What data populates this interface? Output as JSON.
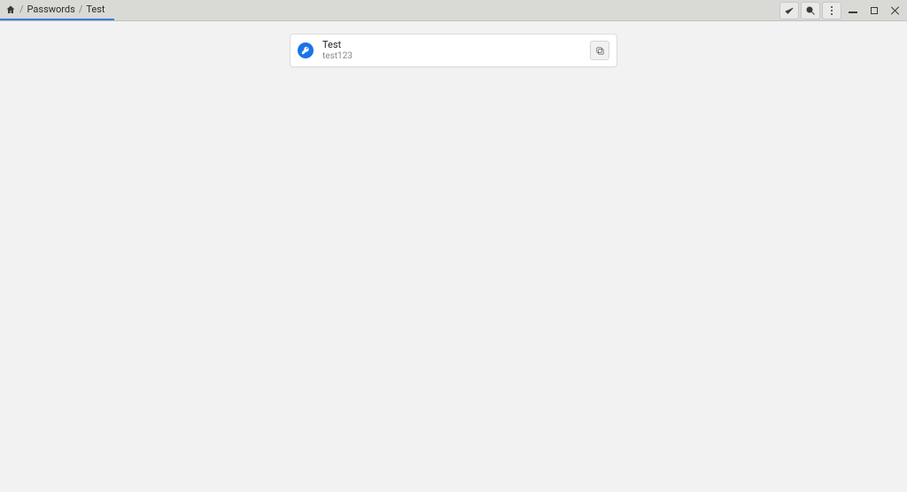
{
  "breadcrumb": {
    "section": "Passwords",
    "item": "Test"
  },
  "entry": {
    "title": "Test",
    "username": "test123"
  }
}
